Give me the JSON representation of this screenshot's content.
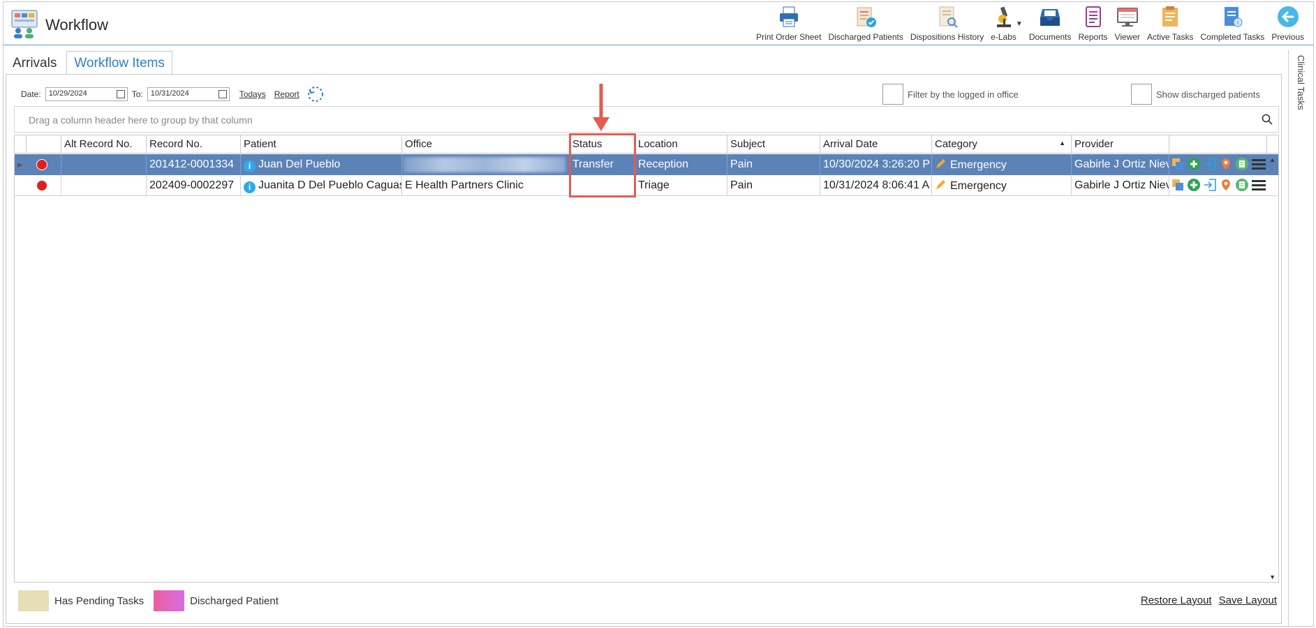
{
  "app": {
    "title": "Workflow"
  },
  "toolbar": {
    "items": [
      {
        "label": "Print Order Sheet",
        "icon": "printer-icon"
      },
      {
        "label": "Discharged Patients",
        "icon": "discharged-patients-icon"
      },
      {
        "label": "Dispositions History",
        "icon": "dispositions-history-icon"
      },
      {
        "label": "e-Labs",
        "icon": "microscope-icon"
      },
      {
        "label": "Documents",
        "icon": "documents-tray-icon"
      },
      {
        "label": "Reports",
        "icon": "reports-icon"
      },
      {
        "label": "Viewer",
        "icon": "viewer-icon"
      },
      {
        "label": "Active Tasks",
        "icon": "active-tasks-icon"
      },
      {
        "label": "Completed Tasks",
        "icon": "completed-tasks-icon"
      },
      {
        "label": "Previous",
        "icon": "back-arrow-icon"
      }
    ]
  },
  "side_panel": {
    "label": "Clinical Tasks"
  },
  "tabs": {
    "arrivals": "Arrivals",
    "workflow_items": "Workflow Items"
  },
  "filters": {
    "date_label": "Date:",
    "date_from": "10/29/2024",
    "to_label": "To:",
    "date_to": "10/31/2024",
    "todays": "Todays",
    "report": "Report",
    "filter_office": "Filter by the logged in office",
    "show_discharged": "Show discharged patients"
  },
  "grid": {
    "group_hint": "Drag a column header here to group by that column",
    "columns": [
      "Alt Record No.",
      "Record No.",
      "Patient",
      "Office",
      "Status",
      "Location",
      "Subject",
      "Arrival Date",
      "Category",
      "Provider"
    ],
    "rows": [
      {
        "alt_record": "",
        "record": "201412-0001334",
        "patient": "Juan Del Pueblo",
        "office": "",
        "status": "Transfer",
        "location": "Reception",
        "subject": "Pain",
        "arrival": "10/30/2024 3:26:20 P",
        "category": "Emergency",
        "provider": "Gabirle J Ortiz Nieve"
      },
      {
        "alt_record": "",
        "record": "202409-0002297",
        "patient": "Juanita D Del Pueblo Caguas",
        "office": "E Health Partners Clinic",
        "status": "",
        "location": "Triage",
        "subject": "Pain",
        "arrival": "10/31/2024 8:06:41 A",
        "category": "Emergency",
        "provider": "Gabirle J Ortiz Nieve"
      }
    ]
  },
  "legend": {
    "pending": "Has Pending Tasks",
    "discharged": "Discharged Patient"
  },
  "footer": {
    "restore": "Restore Layout",
    "save": "Save Layout"
  },
  "colors": {
    "selected_row": "#5b83b8",
    "accent": "#2d7fc6",
    "highlight": "#e55b50",
    "status_dot": "#e41e1e"
  }
}
